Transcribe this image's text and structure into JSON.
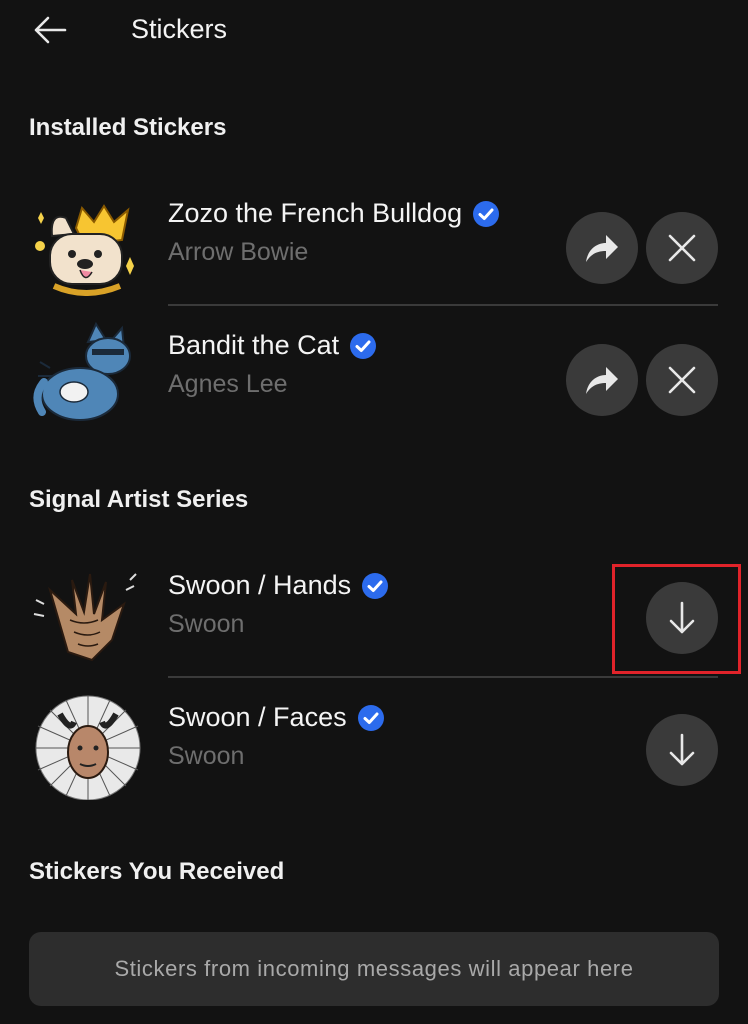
{
  "header": {
    "title": "Stickers",
    "back_icon": "arrow-left-icon"
  },
  "sections": {
    "installed": "Installed Stickers",
    "artist": "Signal Artist Series",
    "received": "Stickers You Received"
  },
  "installed_packs": [
    {
      "name": "Zozo the French Bulldog",
      "author": "Arrow Bowie",
      "verified": true
    },
    {
      "name": "Bandit the Cat",
      "author": "Agnes Lee",
      "verified": true
    }
  ],
  "artist_packs": [
    {
      "name": "Swoon / Hands",
      "author": "Swoon",
      "verified": true
    },
    {
      "name": "Swoon / Faces",
      "author": "Swoon",
      "verified": true
    }
  ],
  "received_empty_text": "Stickers from incoming messages will appear here",
  "colors": {
    "background": "#121212",
    "verified": "#2c6bed",
    "button": "#3a3a3a",
    "highlight": "#e0232a"
  },
  "icons": {
    "share": "share-arrow-icon",
    "remove": "close-icon",
    "download": "download-arrow-icon",
    "verified": "verified-badge-icon"
  }
}
